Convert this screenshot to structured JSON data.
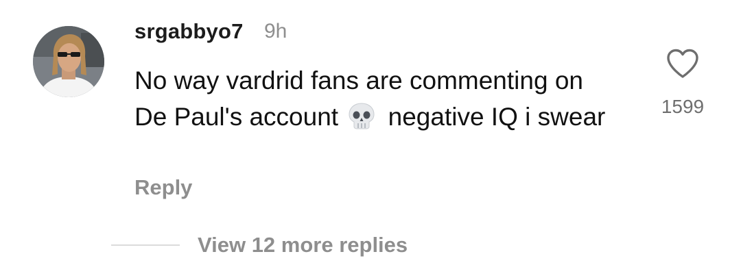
{
  "comment": {
    "username": "srgabbyo7",
    "time": "9h",
    "text_part1": "No way vardrid fans are commenting on De Paul's account",
    "emoji": "skull-emoji",
    "text_part2": "negative IQ i swear",
    "like_icon": "heart-outline-icon",
    "like_count": "1599",
    "reply_label": "Reply"
  },
  "thread": {
    "view_replies_label": "View 12 more replies"
  },
  "colors": {
    "text": "#111111",
    "muted": "#8e8e8e",
    "divider": "#dbdbdb"
  }
}
